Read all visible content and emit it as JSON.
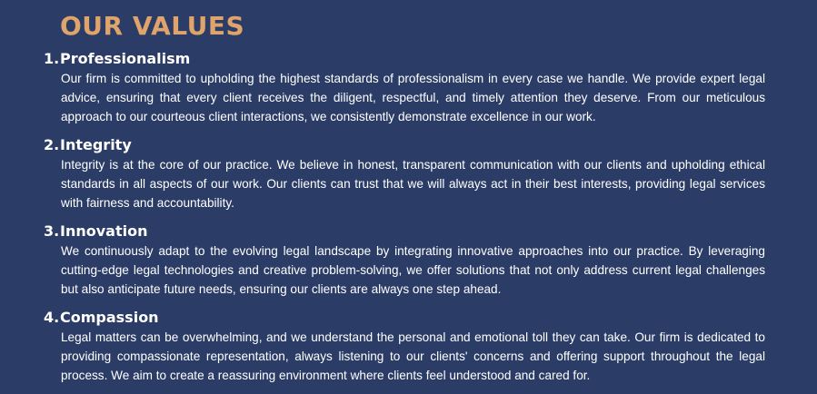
{
  "title": "OUR VALUES",
  "values": [
    {
      "number": "1.",
      "heading": "Professionalism",
      "text": "Our firm is committed to upholding the highest standards of professionalism in every case we handle. We provide expert legal advice, ensuring that every client receives the diligent, respectful, and timely attention they deserve. From our meticulous approach to our courteous client interactions, we consistently demonstrate excellence in our work."
    },
    {
      "number": "2.",
      "heading": "Integrity",
      "text": "Integrity is at the core of our practice. We believe in honest, transparent communication with our clients and upholding ethical standards in all aspects of our work. Our clients can trust that we will always act in their best interests, providing legal services with fairness and accountability."
    },
    {
      "number": "3.",
      "heading": "Innovation",
      "text": "We continuously adapt to the evolving legal landscape by integrating innovative approaches into our practice. By leveraging cutting-edge legal technologies and creative problem-solving, we offer solutions that not only address current legal challenges but also anticipate future needs, ensuring our clients are always one step ahead."
    },
    {
      "number": "4.",
      "heading": "Compassion",
      "text": "Legal matters can be overwhelming, and we understand the personal and emotional toll they can take. Our firm is dedicated to providing compassionate representation, always listening to our clients' concerns and offering support throughout the legal process. We aim to create a reassuring environment where clients feel understood and cared for."
    }
  ],
  "colors": {
    "background": "#2b3c66",
    "title": "#dfa46b",
    "text": "#ffffff"
  }
}
